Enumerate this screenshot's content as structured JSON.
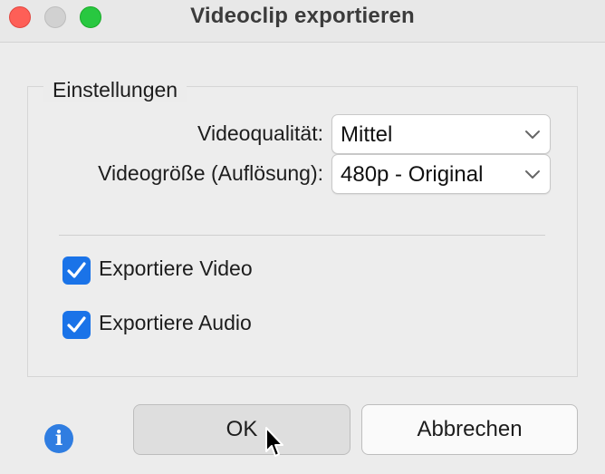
{
  "window": {
    "title": "Videoclip exportieren",
    "controls": {
      "close_color": "#fe5f57",
      "minimize_color": "#d1d1d1",
      "maximize_color": "#28c840"
    }
  },
  "settings": {
    "group_label": "Einstellungen",
    "quality": {
      "label": "Videoqualität:",
      "value": "Mittel"
    },
    "size": {
      "label": "Videogröße (Auflösung):",
      "value": "480p - Original"
    },
    "export_video": {
      "label": "Exportiere Video",
      "checked": true
    },
    "export_audio": {
      "label": "Exportiere Audio",
      "checked": true
    }
  },
  "buttons": {
    "ok_label": "OK",
    "cancel_label": "Abbrechen"
  },
  "info": {
    "glyph": "i",
    "color": "#2f7de1"
  },
  "accent_color": "#1a73e8"
}
